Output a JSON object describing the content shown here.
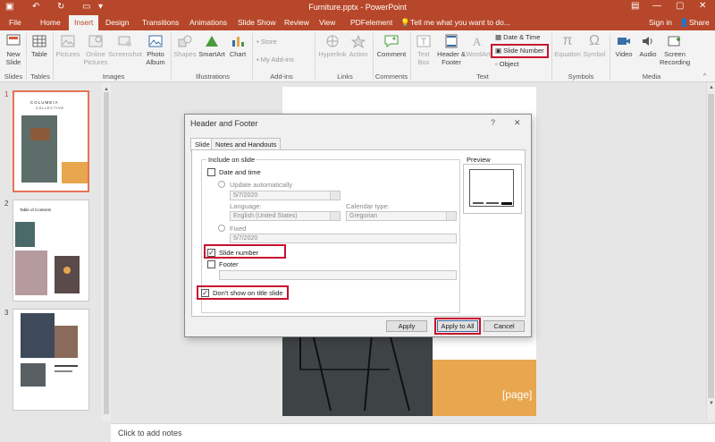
{
  "window": {
    "title": "Furniture.pptx - PowerPoint"
  },
  "tabs": [
    "File",
    "Home",
    "Insert",
    "Design",
    "Transitions",
    "Animations",
    "Slide Show",
    "Review",
    "View",
    "PDFelement"
  ],
  "tell_me": "Tell me what you want to do...",
  "sign_in": "Sign in",
  "share": "Share",
  "ribbon": {
    "new_slide": "New Slide",
    "table": "Table",
    "pictures": "Pictures",
    "online_pictures": "Online Pictures",
    "screenshot": "Screenshot",
    "photo_album": "Photo Album",
    "shapes": "Shapes",
    "smartart": "SmartArt",
    "chart": "Chart",
    "store": "Store",
    "my_addins": "My Add-ins",
    "hyperlink": "Hyperlink",
    "action": "Action",
    "comment": "Comment",
    "text_box": "Text Box",
    "header_footer": "Header & Footer",
    "wordart": "WordArt",
    "date_time": "Date & Time",
    "slide_number": "Slide Number",
    "object": "Object",
    "equation": "Equation",
    "symbol": "Symbol",
    "video": "Video",
    "audio": "Audio",
    "screen_recording": "Screen Recording",
    "groups": {
      "slides": "Slides",
      "tables": "Tables",
      "images": "Images",
      "illustrations": "Illustrations",
      "addins": "Add-ins",
      "links": "Links",
      "comments": "Comments",
      "text": "Text",
      "symbols": "Symbols",
      "media": "Media"
    }
  },
  "thumbnails": [
    {
      "num": "1",
      "brand": "COLUMEIA",
      "sub": "COLLECTIVE"
    },
    {
      "num": "2",
      "heading": "Table of Contents"
    },
    {
      "num": "3"
    }
  ],
  "slide_mark": "[page]",
  "notes": "Click to add notes",
  "dialog": {
    "title": "Header and Footer",
    "help": "?",
    "close": "✕",
    "tab_slide": "Slide",
    "tab_notes": "Notes and Handouts",
    "include_on_slide": "Include on slide",
    "date_and_time": "Date and time",
    "update_automatically": "Update automatically",
    "date_value": "5/7/2020",
    "language_label": "Language:",
    "language_value": "English (United States)",
    "calendar_label": "Calendar type:",
    "calendar_value": "Gregorian",
    "fixed": "Fixed",
    "fixed_value": "5/7/2020",
    "slide_number": "Slide number",
    "footer": "Footer",
    "dont_show_title": "Don't show on title slide",
    "preview": "Preview",
    "apply": "Apply",
    "apply_all": "Apply to All",
    "cancel": "Cancel"
  },
  "colors": {
    "accent": "#b7472a",
    "highlight": "#c8102e",
    "slide_orange": "#e8a64e"
  }
}
